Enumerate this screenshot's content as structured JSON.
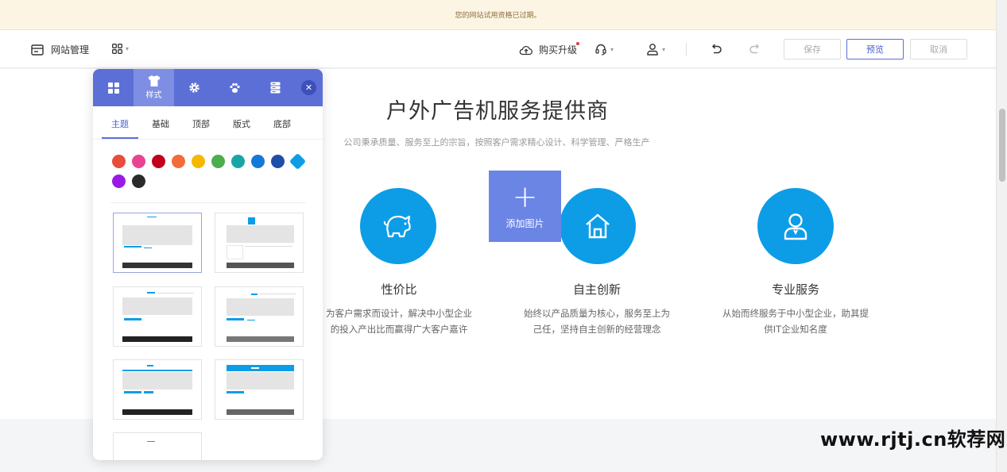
{
  "notice": "您的网站试用资格已过期。",
  "toolbar": {
    "site_manage": "网站管理",
    "buy_upgrade": "购买升级",
    "save": "保存",
    "preview": "预览",
    "cancel": "取消"
  },
  "site": {
    "title": "户外广告机服务提供商",
    "subtitle": "公司秉承质量、服务至上的宗旨，按照客户需求精心设计、科学管理、严格生产",
    "add_image": "添加图片",
    "features": [
      {
        "title": "性价比",
        "desc1": "为客户需求而设计，解决中小型企业",
        "desc2": "的投入产出比而赢得广大客户嘉许",
        "icon": "piggy-bank-icon"
      },
      {
        "title": "自主创新",
        "desc1": "始终以产品质量为核心，服务至上为",
        "desc2": "己任，坚持自主创新的经营理念",
        "icon": "home-icon"
      },
      {
        "title": "专业服务",
        "desc1": "从始而终服务于中小型企业，助其提",
        "desc2": "供IT企业知名度",
        "icon": "user-icon"
      }
    ]
  },
  "panel": {
    "tabs": [
      {
        "icon": "grid-icon",
        "label": ""
      },
      {
        "icon": "shirt-icon",
        "label": "样式"
      },
      {
        "icon": "gear-icon",
        "label": ""
      },
      {
        "icon": "paw-icon",
        "label": ""
      },
      {
        "icon": "database-icon",
        "label": ""
      }
    ],
    "subtabs": [
      "主题",
      "基础",
      "顶部",
      "版式",
      "底部"
    ],
    "colors": [
      "#e74c3c",
      "#e84393",
      "#c0001d",
      "#f26b3a",
      "#f5b800",
      "#4cae4c",
      "#1aa5a5",
      "#1579d9",
      "#1f4ea8",
      "#0d9de7",
      "#9b19e6",
      "#2b2b2b"
    ],
    "selected_color": "#0d9de7"
  },
  "watermark": "www.rjtj.cn软荐网"
}
